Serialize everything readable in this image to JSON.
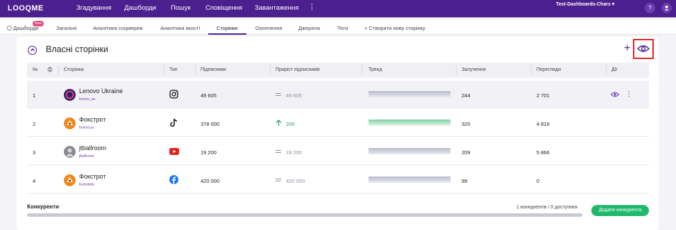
{
  "app": {
    "logo": "LOOQME",
    "dashboard_name": "Test-Dashboards-Chars ▾",
    "help": "?"
  },
  "nav": [
    "Згадування",
    "Дашборди",
    "Пошук",
    "Сповіщення",
    "Завантаження"
  ],
  "tabs": {
    "items": [
      "Дашборди",
      "Загальні",
      "Аналітика соцмереж",
      "Аналітика якості",
      "Сторінки",
      "Охоплення",
      "Джерела",
      "Теги",
      "+ Створити нову сторінку"
    ],
    "new_badge": "New",
    "active": "Сторінки"
  },
  "section": {
    "title": "Власні сторінки",
    "plus": "+"
  },
  "table": {
    "columns": [
      "№",
      "Сторінка",
      "Тип",
      "Підписники",
      "Приріст підписників",
      "Тренд",
      "Залучення",
      "Перегляди",
      "Дії"
    ],
    "rows": [
      {
        "num": "1",
        "name": "Lenovo Ukraine",
        "handle": "lenovo_ua",
        "type_icon": "instagram-icon",
        "followers": "49 605",
        "growth": "49 605",
        "growth_dir": "flat",
        "engagement": "244",
        "views": "2 701"
      },
      {
        "num": "2",
        "name": "Фокстрот",
        "handle": "foxtrot.ua",
        "type_icon": "tiktok-icon",
        "followers": "378 000",
        "growth": "200",
        "growth_dir": "up",
        "engagement": "320",
        "views": "4 816"
      },
      {
        "num": "3",
        "name": "jtballroom",
        "handle": "jtballroom",
        "type_icon": "youtube-icon",
        "followers": "19 200",
        "growth": "19 200",
        "growth_dir": "flat",
        "engagement": "209",
        "views": "5 866"
      },
      {
        "num": "4",
        "name": "Фокстрот",
        "handle": "foxtrotinfo",
        "type_icon": "facebook-icon",
        "followers": "420 000",
        "growth": "420 000",
        "growth_dir": "flat",
        "engagement": "99",
        "views": "0"
      }
    ]
  },
  "competitors": {
    "title": "Конкуренти",
    "count": "1 конкурентів / 0 доступних",
    "add_button": "Додати конкурента"
  },
  "colors": {
    "brand": "#4b1f8e",
    "accent_green": "#20b96a",
    "highlight": "#e02424"
  }
}
